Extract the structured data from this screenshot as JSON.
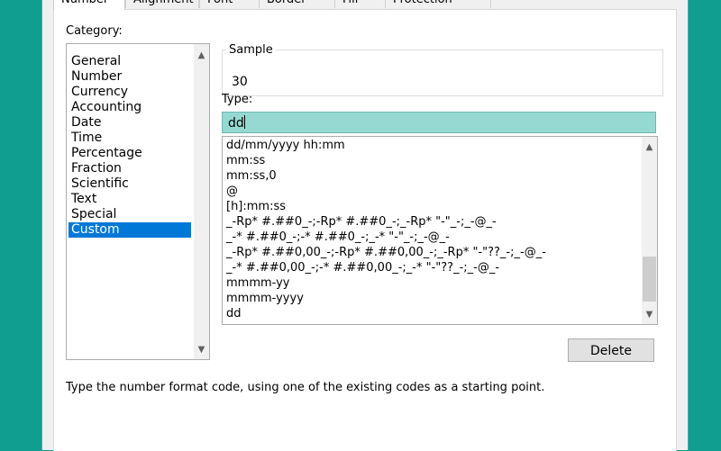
{
  "tabs": [
    {
      "label": "Number",
      "active": true
    },
    {
      "label": "Alignment",
      "active": false
    },
    {
      "label": "Font",
      "active": false
    },
    {
      "label": "Border",
      "active": false
    },
    {
      "label": "Fill",
      "active": false
    },
    {
      "label": "Protection",
      "active": false
    }
  ],
  "category": {
    "label": "Category:",
    "items": [
      "General",
      "Number",
      "Currency",
      "Accounting",
      "Date",
      "Time",
      "Percentage",
      "Fraction",
      "Scientific",
      "Text",
      "Special",
      "Custom"
    ],
    "selected": "Custom"
  },
  "sample": {
    "label": "Sample",
    "value": "30"
  },
  "type": {
    "label": "Type:",
    "value": "dd",
    "formats": [
      "dd/mm/yyyy hh:mm",
      "mm:ss",
      "mm:ss,0",
      "@",
      "[h]:mm:ss",
      "_-Rp* #.##0_-;-Rp* #.##0_-;_-Rp* \"-\"_-;_-@_-",
      "_-* #.##0_-;-* #.##0_-;_-* \"-\"_-;_-@_-",
      "_-Rp* #.##0,00_-;-Rp* #.##0,00_-;_-Rp* \"-\"??_-;_-@_-",
      "_-* #.##0,00_-;-* #.##0,00_-;_-* \"-\"??_-;_-@_-",
      "mmmm-yy",
      "mmmm-yyyy",
      "dd"
    ]
  },
  "buttons": {
    "delete_label": "Delete"
  },
  "hint": "Type the number format code, using one of the existing codes as a starting point.",
  "colors": {
    "selection": "#0078d7",
    "input_highlight": "#96d9d2",
    "background": "#0f9e90"
  },
  "icons": {
    "scroll_up": "chevron-up-icon",
    "scroll_down": "chevron-down-icon"
  }
}
